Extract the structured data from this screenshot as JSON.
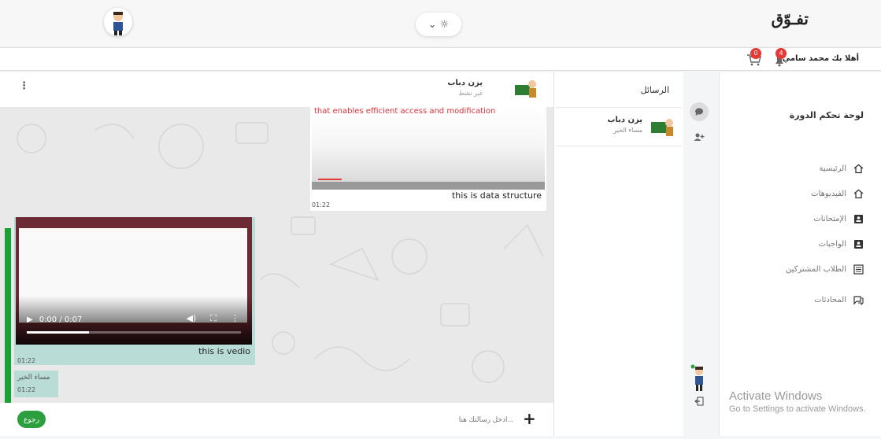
{
  "header": {
    "brand": "تفـوّق",
    "theme_toggle": "⌄ ☼"
  },
  "subbar": {
    "welcome": "أهلا بك محمد سامي",
    "notifications_count": "4",
    "cart_count": "0"
  },
  "sidebar": {
    "title": "لوحة تحكم الدورة",
    "items": [
      {
        "label": "الرئيسية",
        "icon": "home-icon"
      },
      {
        "label": "الفيديوهات",
        "icon": "home-icon"
      },
      {
        "label": "الإمتحانات",
        "icon": "contact-card-icon"
      },
      {
        "label": "الواجبات",
        "icon": "contact-card-icon"
      },
      {
        "label": "الطلاب المشتركين",
        "icon": "list-icon"
      },
      {
        "label": "المحادثات",
        "icon": "chat-icon"
      }
    ]
  },
  "watermark": {
    "line1": "Activate Windows",
    "line2": "Go to Settings to activate Windows."
  },
  "conversations": {
    "title": "الرسائل",
    "items": [
      {
        "name": "يزن دباب",
        "last_message": "مساء الخير"
      }
    ]
  },
  "chat": {
    "contact_name": "يزن دباب",
    "contact_status": "غير نشط",
    "messages": [
      {
        "video_text": "that enables efficient access and modification",
        "caption": "this is data structure",
        "time": "01:22"
      },
      {
        "video_time": "0:00 / 0:07",
        "video_progress": 0.29,
        "caption": "this is vedio",
        "time": "01:22"
      },
      {
        "text": "مساء الخير",
        "time": "01:22"
      }
    ],
    "input_placeholder": "ادخل رسالتك هنا...",
    "back_label": "رجوع"
  },
  "colors": {
    "accent_green": "#2e9f3f",
    "badge_red": "#e53935",
    "bubble_out": "#b9ddd6"
  }
}
